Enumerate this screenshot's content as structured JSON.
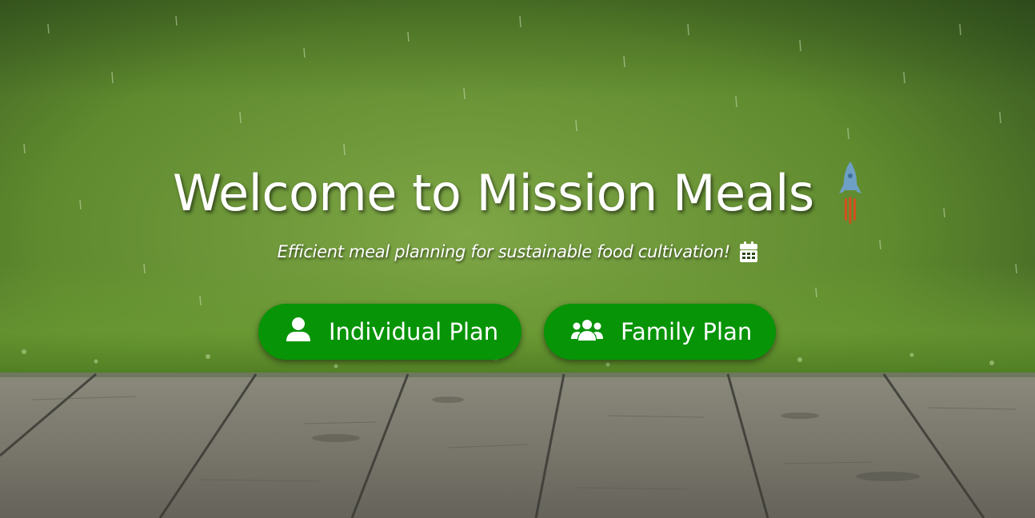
{
  "hero": {
    "title": "Welcome to Mission Meals",
    "title_icon": "rocket-icon",
    "subtitle": "Efficient meal planning for sustainable food cultivation!",
    "subtitle_icon": "calendar-icon"
  },
  "buttons": [
    {
      "label": "Individual Plan",
      "icon": "user-icon"
    },
    {
      "label": "Family Plan",
      "icon": "users-icon"
    }
  ],
  "colors": {
    "button_bg": "#079407",
    "grass": "#6a9a34",
    "wood": "#7c7a70",
    "rocket_body": "#6da0c4",
    "rocket_flame": "#d2501e"
  }
}
